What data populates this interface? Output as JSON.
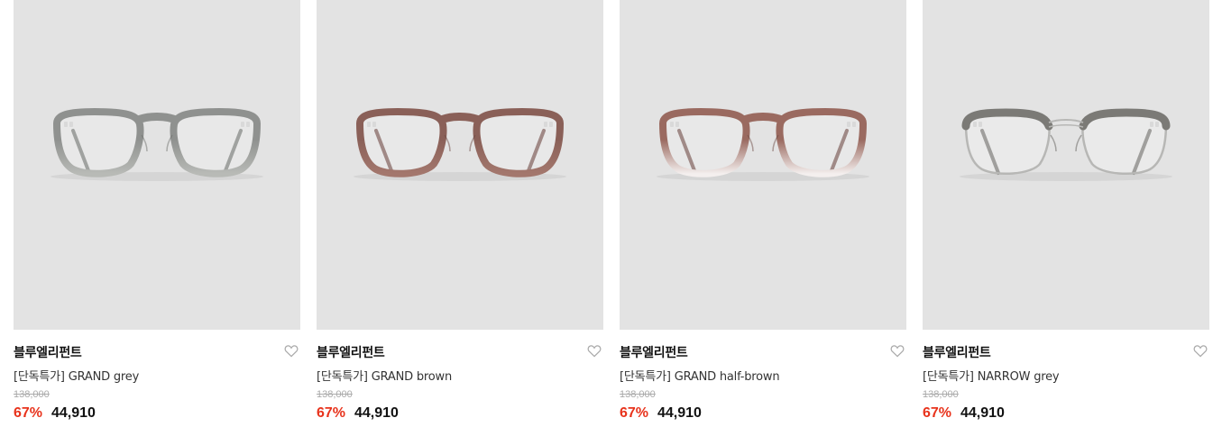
{
  "colors": {
    "accent": "#e8331c",
    "tile_bg": "#e3e3e3"
  },
  "products": [
    {
      "brand": "블루엘리펀트",
      "name": "[단독특가] GRAND grey",
      "original_price": "138,000",
      "discount_rate": "67%",
      "sale_price": "44,910",
      "image_icon": "glasses-image",
      "frame": {
        "front": "#8f918f",
        "lower": "#b8bab6",
        "temple": "#6f716e",
        "style": "acetate"
      }
    },
    {
      "brand": "블루엘리펀트",
      "name": "[단독특가] GRAND brown",
      "original_price": "138,000",
      "discount_rate": "67%",
      "sale_price": "44,910",
      "image_icon": "glasses-image",
      "frame": {
        "front": "#8a6058",
        "lower": "#a3776d",
        "temple": "#6d4a44",
        "style": "acetate"
      }
    },
    {
      "brand": "블루엘리펀트",
      "name": "[단독특가] GRAND half-brown",
      "original_price": "138,000",
      "discount_rate": "67%",
      "sale_price": "44,910",
      "image_icon": "glasses-image",
      "frame": {
        "front": "#9a6a60",
        "lower": "#f4efee",
        "temple": "#6e4b45",
        "style": "acetate"
      }
    },
    {
      "brand": "블루엘리펀트",
      "name": "[단독특가] NARROW grey",
      "original_price": "138,000",
      "discount_rate": "67%",
      "sale_price": "44,910",
      "image_icon": "glasses-image",
      "frame": {
        "front": "#7b7a76",
        "lower": "#b7b7b5",
        "temple": "#5f5e5a",
        "style": "browline"
      }
    }
  ]
}
